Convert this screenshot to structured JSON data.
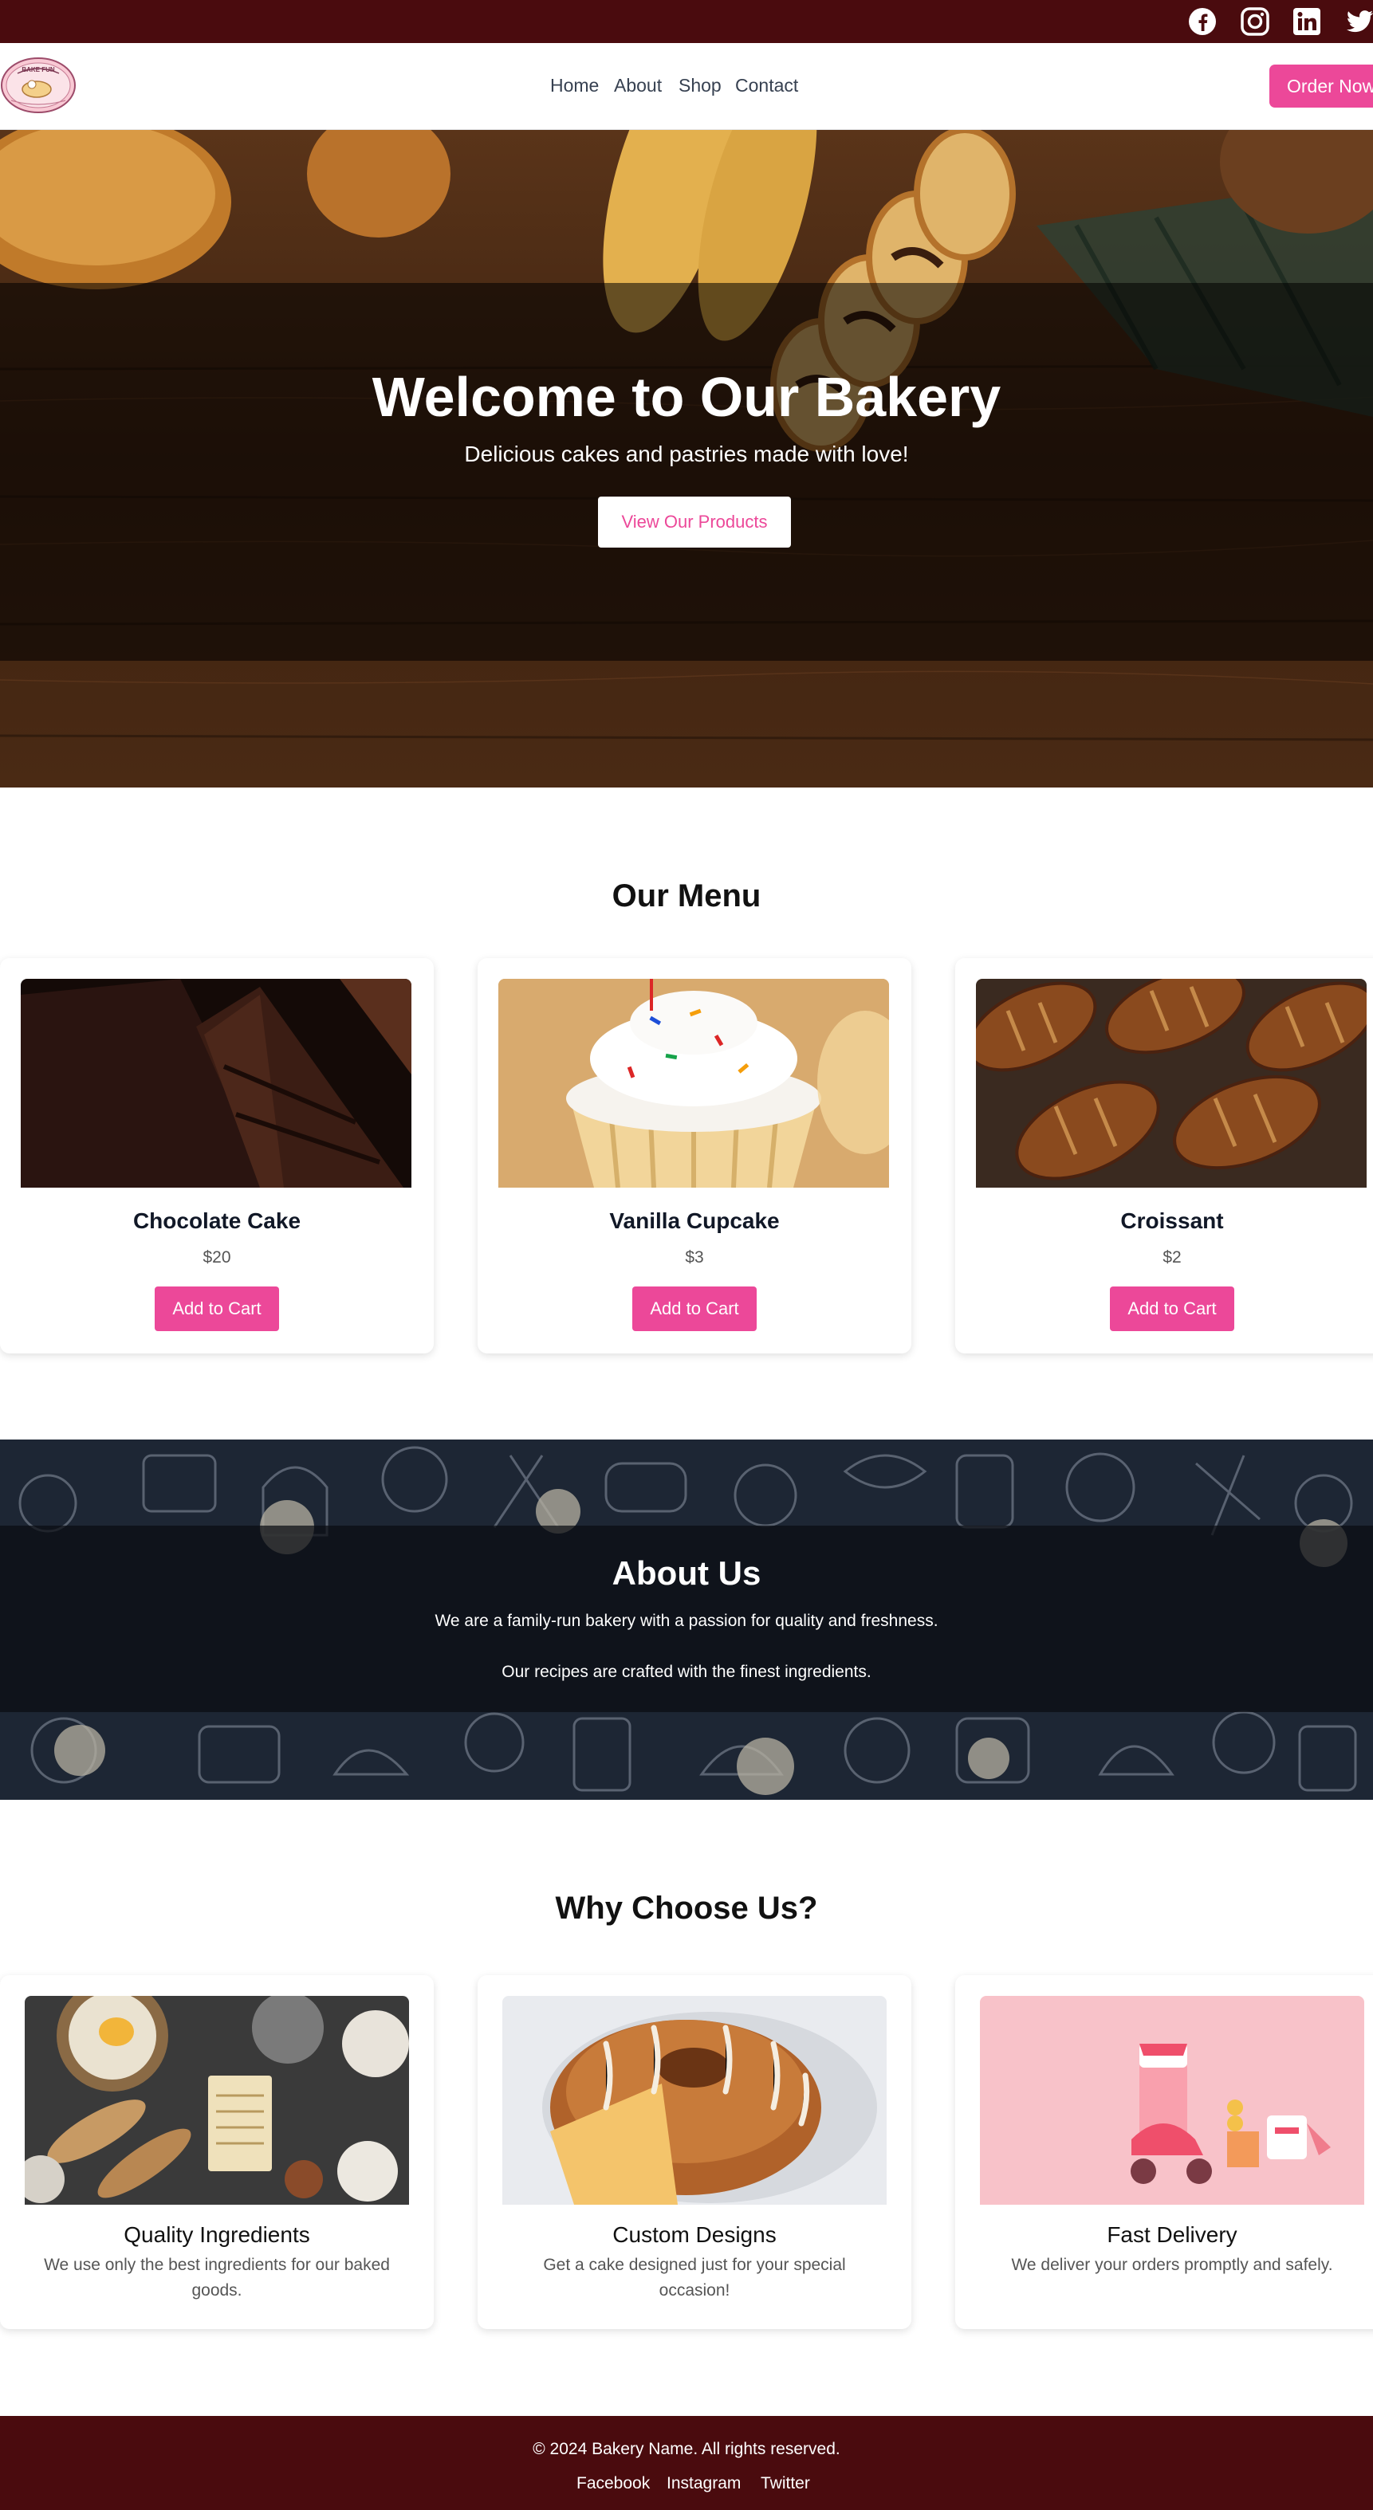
{
  "social_bar": {
    "icons": [
      "facebook-icon",
      "instagram-icon",
      "linkedin-icon",
      "twitter-icon"
    ],
    "background": "#4a0b0e"
  },
  "header": {
    "logo_text": "BAKE FUN",
    "nav": [
      "Home",
      "About",
      "Shop",
      "Contact"
    ],
    "order_button": "Order Now"
  },
  "hero": {
    "title": "Welcome to Our Bakery",
    "subtitle": "Delicious cakes and pastries made with love!",
    "button": "View Our Products"
  },
  "menu": {
    "title": "Our Menu",
    "items": [
      {
        "name": "Chocolate Cake",
        "price": "$20",
        "button": "Add to Cart",
        "image": "chocolate-cake-photo"
      },
      {
        "name": "Vanilla Cupcake",
        "price": "$3",
        "button": "Add to Cart",
        "image": "vanilla-cupcake-photo"
      },
      {
        "name": "Croissant",
        "price": "$2",
        "button": "Add to Cart",
        "image": "croissant-photo"
      }
    ]
  },
  "about": {
    "title": "About Us",
    "line1": "We are a family-run bakery with a passion for quality and freshness.",
    "line2": "Our recipes are crafted with the finest ingredients."
  },
  "why": {
    "title": "Why Choose Us?",
    "items": [
      {
        "title": "Quality Ingredients",
        "desc": "We use only the best ingredients for our baked goods.",
        "image": "ingredients-photo"
      },
      {
        "title": "Custom Designs",
        "desc": "Get a cake designed just for your special occasion!",
        "image": "bundt-cake-photo"
      },
      {
        "title": "Fast Delivery",
        "desc": "We deliver your orders promptly and safely.",
        "image": "delivery-scooter-illustration"
      }
    ]
  },
  "footer": {
    "copyright": "© 2024 Bakery Name. All rights reserved.",
    "links": [
      "Facebook",
      "Instagram",
      "Twitter"
    ]
  },
  "colors": {
    "accent": "#ec4899",
    "maroon": "#4a0b0e",
    "about_bg": "#1d2634"
  }
}
